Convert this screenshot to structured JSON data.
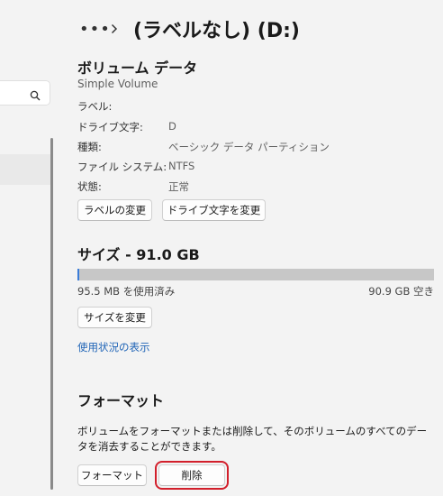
{
  "header": {
    "more_label": "•••",
    "title": "(ラベルなし) (D:)"
  },
  "volume": {
    "heading": "ボリューム データ",
    "subtitle": "Simple Volume",
    "props": [
      {
        "label": "ラベル:",
        "value": ""
      },
      {
        "label": "ドライブ文字:",
        "value": "D"
      },
      {
        "label": "種類:",
        "value": "ベーシック データ パーティション"
      },
      {
        "label": "ファイル システム:",
        "value": "NTFS"
      },
      {
        "label": "状態:",
        "value": "正常"
      }
    ],
    "change_label_button": "ラベルの変更",
    "change_letter_button": "ドライブ文字を変更"
  },
  "size": {
    "heading": "サイズ - 91.0 GB",
    "used_text": "95.5 MB を使用済み",
    "free_text": "90.9 GB 空き",
    "used_fraction": 0.001,
    "resize_button": "サイズを変更",
    "usage_link": "使用状況の表示"
  },
  "format": {
    "heading": "フォーマット",
    "description": "ボリュームをフォーマットまたは削除して、そのボリュームのすべてのデータを消去することができます。",
    "format_button": "フォーマット",
    "delete_button": "削除"
  },
  "colors": {
    "accent": "#1e63b6",
    "highlight": "#d21f2b",
    "bar_track": "#c7c7c7"
  }
}
